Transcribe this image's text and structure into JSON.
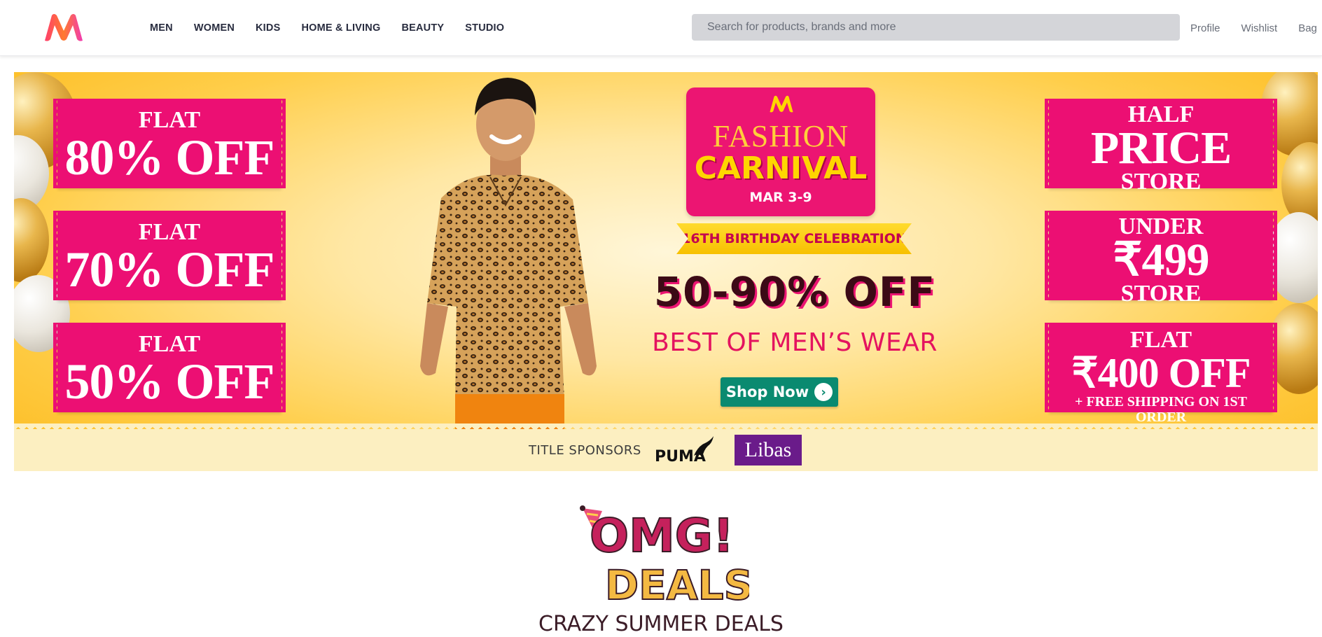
{
  "header": {
    "nav": [
      "MEN",
      "WOMEN",
      "KIDS",
      "HOME & LIVING",
      "BEAUTY",
      "STUDIO"
    ],
    "search_placeholder": "Search for products, brands and more",
    "actions": [
      "Profile",
      "Wishlist",
      "Bag"
    ]
  },
  "banner": {
    "left_tiles": [
      {
        "top": "FLAT",
        "main": "80% OFF"
      },
      {
        "top": "FLAT",
        "main": "70% OFF"
      },
      {
        "top": "FLAT",
        "main": "50% OFF"
      }
    ],
    "right_tiles": [
      {
        "top": "HALF",
        "main": "PRICE",
        "bottom": "STORE"
      },
      {
        "top": "UNDER",
        "main": "₹499",
        "bottom": "STORE"
      },
      {
        "top": "FLAT",
        "main": "₹400 OFF",
        "bottom": "+ FREE SHIPPING ON 1ST ORDER"
      }
    ],
    "event_line1": "FASHION",
    "event_line2": "CARNIVAL",
    "event_dates": "MAR 3-9",
    "ribbon": "16TH BIRTHDAY CELEBRATION",
    "discount": "50-90% OFF",
    "category": "BEST OF MEN’S WEAR",
    "cta": "Shop Now",
    "sponsor_label": "TITLE SPONSORS",
    "sponsors": [
      "PUMA",
      "Libas"
    ],
    "colors": {
      "pink": "#ec0f73",
      "yellow": "#ffce4a",
      "green": "#0a8a70"
    }
  },
  "deals": {
    "line1": "OMG!",
    "line2": "DEALS",
    "subtitle": "CRAZY SUMMER DEALS"
  }
}
